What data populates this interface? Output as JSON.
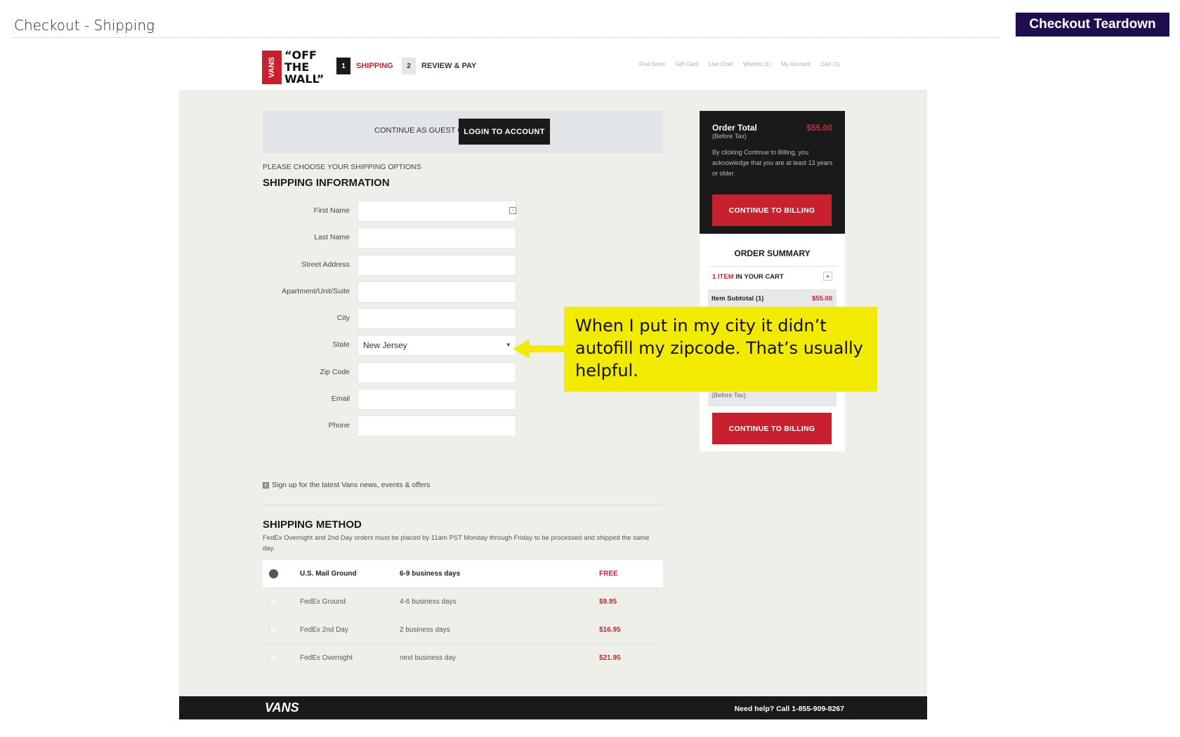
{
  "teardown": {
    "title": "Checkout - Shipping",
    "badge": "Checkout Teardown"
  },
  "header": {
    "logo_brand": "VANS",
    "logo_tagline": "“OFF THE WALL”",
    "steps": [
      {
        "num": "1",
        "label": "SHIPPING"
      },
      {
        "num": "2",
        "label": "REVIEW & PAY"
      }
    ],
    "util_nav": [
      "Find Store",
      "Gift Card",
      "Live Chat",
      "Wishlist (1)",
      "My Account",
      "Cart (1)"
    ]
  },
  "guest": {
    "text": "CONTINUE AS GUEST OR",
    "login_label": "LOGIN TO ACCOUNT"
  },
  "shipping_options_label": "PLEASE CHOOSE YOUR SHIPPING OPTIONS",
  "shipping_info": {
    "title": "SHIPPING INFORMATION",
    "fields": [
      {
        "label": "First Name",
        "value": ""
      },
      {
        "label": "Last Name",
        "value": ""
      },
      {
        "label": "Street Address",
        "value": ""
      },
      {
        "label": "Apartment/Unit/Suite",
        "value": ""
      },
      {
        "label": "City",
        "value": ""
      },
      {
        "label": "State",
        "value": "New Jersey"
      },
      {
        "label": "Zip Code",
        "value": ""
      },
      {
        "label": "Email",
        "value": ""
      },
      {
        "label": "Phone",
        "value": ""
      }
    ],
    "signup": "Sign up for the latest Vans news, events & offers"
  },
  "shipping_method": {
    "title": "SHIPPING METHOD",
    "note": "FedEx Overnight and 2nd Day orders must be placed by 11am PST Monday through Friday to be processed and shipped the same day.",
    "options": [
      {
        "name": "U.S. Mail Ground",
        "days": "6-9 business days",
        "price": "FREE"
      },
      {
        "name": "FedEx Ground",
        "days": "4-6 business days",
        "price": "$9.95"
      },
      {
        "name": "FedEx 2nd Day",
        "days": "2 business days",
        "price": "$16.95"
      },
      {
        "name": "FedEx Overnight",
        "days": "next business day",
        "price": "$21.95"
      }
    ]
  },
  "order": {
    "total_label": "Order Total",
    "before_tax": "(Before Tax)",
    "total": "$55.00",
    "note": "By clicking Continue to Billing, you acknowledge that you are at least 13 years or older.",
    "continue_label": "CONTINUE TO BILLING"
  },
  "summary": {
    "title": "ORDER SUMMARY",
    "items_count": "1 ITEM",
    "items_suffix": " IN YOUR CART",
    "plus": "+",
    "subtotal_label": "Item Subtotal (1)",
    "subtotal_value": "$55.00",
    "before_tax": "(Before Tax)",
    "continue_label": "CONTINUE TO BILLING"
  },
  "footer": {
    "logo": "VANS",
    "help": "Need help? Call 1-855-909-8267"
  },
  "annotation": {
    "text": "When I put in my city it didn’t autofill my zipcode. That’s usually helpful.",
    "color": "#f2ea00"
  },
  "colors": {
    "brand_red": "#c8202f",
    "badge_purple": "#1f0d4d",
    "dark": "#1a1a1a"
  }
}
